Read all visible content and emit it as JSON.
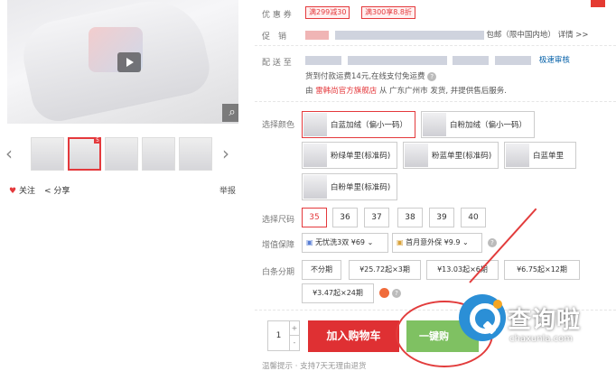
{
  "gallery": {
    "badge": "5",
    "follow_label": "关注",
    "share_label": "分享",
    "report_label": "举报"
  },
  "details": {
    "coupon_label": "优 惠 券",
    "coupons": [
      "满299减30",
      "满300享8.8折"
    ],
    "promo_label": "促　销",
    "promo_text": "包邮（限中国内地） 详情 >>",
    "shipping_label": "配 送 至",
    "shipping_link": "极速审核",
    "ship_note": "货到付款运费14元,在线支付免运费",
    "ship_from_prefix": "由",
    "shop_name": "雷韩尚官方旗舰店",
    "ship_from_suffix": "从 广东广州市 发货, 并提供售后服务."
  },
  "colors": {
    "label": "选择颜色",
    "options": [
      "白蓝加绒（偏小一码）",
      "白粉加绒（偏小一码）",
      "粉绿单里(标准码)",
      "粉蓝单里(标准码)",
      "白蓝单里",
      "白粉单里(标准码)"
    ]
  },
  "sizes": {
    "label": "选择尺码",
    "options": [
      "35",
      "36",
      "37",
      "38",
      "39",
      "40"
    ]
  },
  "services": {
    "label": "增值保障",
    "options": [
      "无忧洗3双 ¥69",
      "首月意外保 ¥9.9"
    ]
  },
  "installments": {
    "label": "白条分期",
    "options": [
      "不分期",
      "¥25.72起×3期",
      "¥13.03起×6期",
      "¥6.75起×12期",
      "¥3.47起×24期"
    ]
  },
  "purchase": {
    "quantity": "1",
    "plus": "+",
    "minus": "-",
    "add_to_cart": "加入购物车",
    "buy_now": "一键购"
  },
  "tip": "温馨提示 · 支持7天无理由退货",
  "watermark": {
    "text": "查询啦",
    "url": "chaxunla.com"
  }
}
